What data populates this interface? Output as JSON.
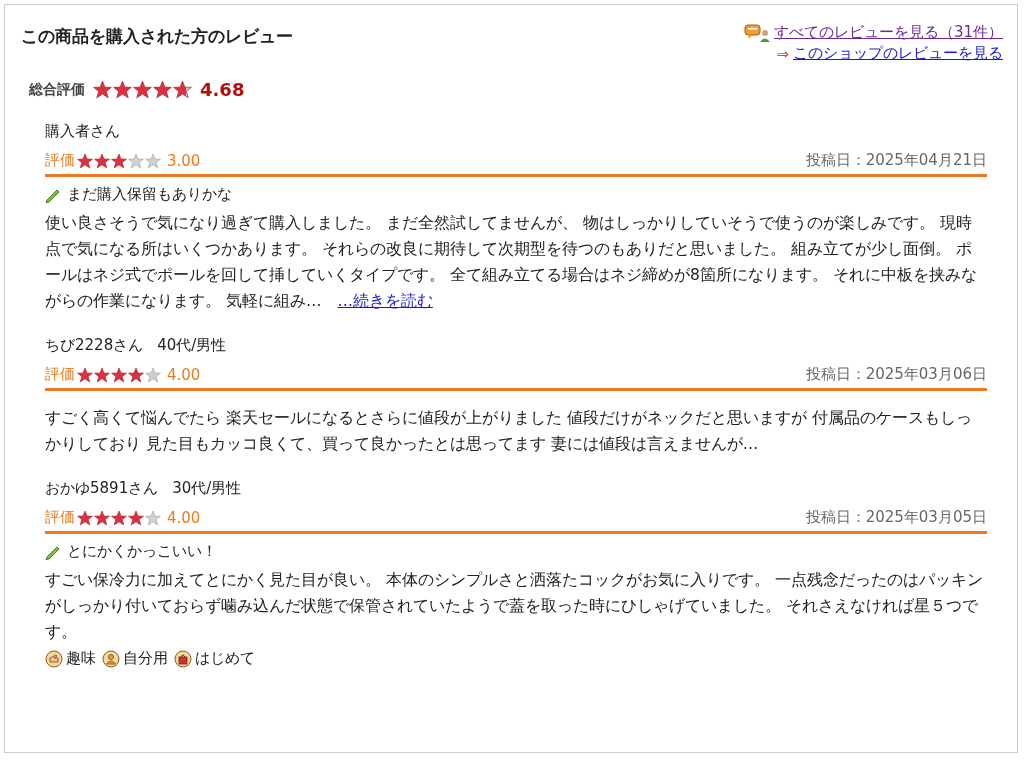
{
  "header": {
    "title": "この商品を購入された方のレビュー",
    "all_reviews_link": "すべてのレビューを見る（31件）",
    "shop_arrow": "⇒",
    "shop_reviews_link": "このショップのレビューを見る"
  },
  "overall": {
    "label": "総合評価",
    "stars": 4.68,
    "score": "4.68"
  },
  "reviews": [
    {
      "reviewer": "購入者さん",
      "rating_label": "評価",
      "stars": 3,
      "score": "3.00",
      "date": "投稿日：2025年04月21日",
      "title": "まだ購入保留もありかな",
      "body": "使い良さそうで気になり過ぎて購入しました。 まだ全然試してませんが、 物はしっかりしていそうで使うのが楽しみです。 現時点で気になる所はいくつかあります。 それらの改良に期待して次期型を待つのもありだと思いました。 組み立てが少し面倒。 ポールはネジ式でポールを回して挿していくタイプです。 全て組み立てる場合はネジ締めが8箇所になります。 それに中板を挟みながらの作業になります。 気軽に組み…",
      "read_more": "…続きを読む"
    },
    {
      "reviewer": "ちび2228さん",
      "profile": "40代/男性",
      "rating_label": "評価",
      "stars": 4,
      "score": "4.00",
      "date": "投稿日：2025年03月06日",
      "body": "すごく高くて悩んでたら 楽天セールになるとさらに値段が上がりました 値段だけがネックだと思いますが 付属品のケースもしっかりしており 見た目もカッコ良くて、買って良かったとは思ってます 妻には値段は言えませんが…"
    },
    {
      "reviewer": "おかゆ5891さん",
      "profile": "30代/男性",
      "rating_label": "評価",
      "stars": 4,
      "score": "4.00",
      "date": "投稿日：2025年03月05日",
      "title": "とにかくかっこいい！",
      "body": "すごい保冷力に加えてとにかく見た目が良い。 本体のシンプルさと洒落たコックがお気に入りです。 一点残念だったのはパッキンがしっかり付いておらず噛み込んだ状態で保管されていたようで蓋を取った時にひしゃげていました。 それさえなければ星５つです。",
      "tags": [
        {
          "kind": "hobby",
          "label": "趣味"
        },
        {
          "kind": "self",
          "label": "自分用"
        },
        {
          "kind": "first",
          "label": "はじめて"
        }
      ]
    }
  ]
}
